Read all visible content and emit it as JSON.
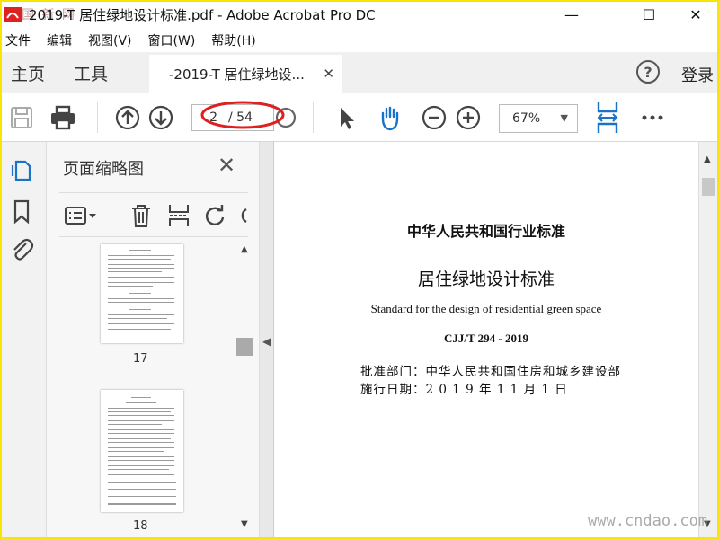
{
  "window": {
    "title": "2019-T 居住绿地设计标准.pdf - Adobe Acrobat Pro DC",
    "watermark_left": "国 新 网",
    "minimize_glyph": "—",
    "maximize_glyph": "☐",
    "close_glyph": "✕"
  },
  "menu": [
    "文件",
    "编辑",
    "视图(V)",
    "窗口(W)",
    "帮助(H)"
  ],
  "tabs": {
    "home": "主页",
    "tools": "工具",
    "document_tab": "-2019-T 居住绿地设...",
    "tab_close": "✕",
    "help": "?",
    "login": "登录"
  },
  "toolbar": {
    "icons": [
      "save-icon",
      "print-icon",
      "page-up-icon",
      "page-down-icon",
      "select-cursor-icon",
      "hand-tool-icon",
      "zoom-out-icon",
      "zoom-in-icon",
      "fit-page-icon",
      "more-icon"
    ],
    "current_page": "2",
    "page_total": "/ 54",
    "zoom": "67%"
  },
  "thumbnails_panel": {
    "title": "页面缩略图",
    "close": "✕",
    "pages": [
      {
        "number": "17"
      },
      {
        "number": "18"
      }
    ]
  },
  "document": {
    "heading": "中华人民共和国行业标准",
    "title": "居住绿地设计标准",
    "english_title": "Standard for the design of residential green space",
    "code": "CJJ/T 294 - 2019",
    "approval": "批准部门：中华人民共和国住房和城乡建设部",
    "effective": "施行日期：2 0 1 9  年  1 1  月  1  日"
  },
  "watermark_br": "www.cndao.com",
  "colors": {
    "accent": "#1a73c8",
    "border_highlight": "#f7e600",
    "annotation": "#e02020"
  }
}
